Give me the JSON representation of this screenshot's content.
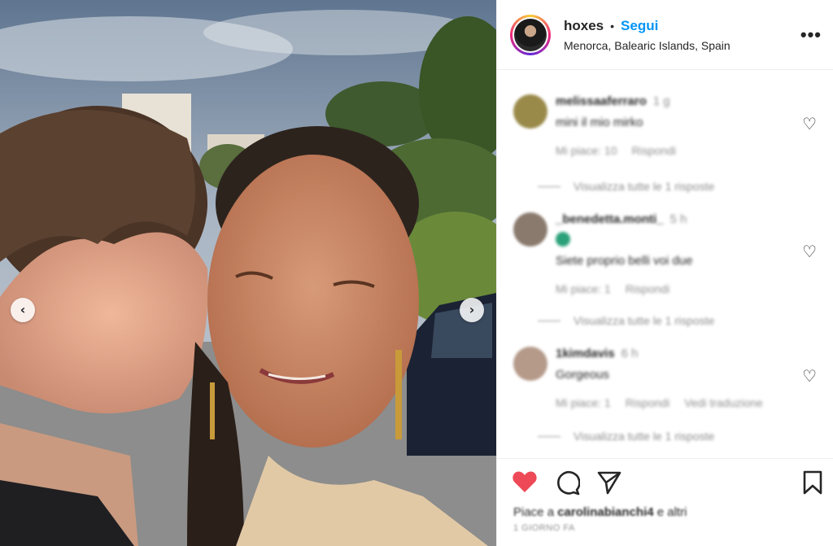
{
  "post": {
    "username": "hoxes",
    "separator": "•",
    "follow_label": "Segui",
    "location": "Menorca, Balearic Islands, Spain",
    "more_label": "•••"
  },
  "media": {
    "prev_glyph": "‹",
    "next_glyph": "›"
  },
  "comments": [
    {
      "user": "melissaaferraro",
      "time": "1 g",
      "text": "mini il mio mirko",
      "meta": [
        "Mi piace: 10",
        "Rispondi"
      ],
      "replies": "Visualizza tutte le 1 risposte",
      "avatar_color": "#9a8a4a",
      "verified": false
    },
    {
      "user": "_benedetta.monti_",
      "time": "5 h",
      "text": "Siete proprio belli voi due",
      "meta": [
        "Mi piace: 1",
        "Rispondi"
      ],
      "replies": "Visualizza tutte le 1 risposte",
      "avatar_color": "#8a7a6e",
      "verified": true
    },
    {
      "user": "1kimdavis",
      "time": "6 h",
      "text": "Gorgeous",
      "meta": [
        "Mi piace: 1",
        "Rispondi",
        "Vedi traduzione"
      ],
      "replies": "Visualizza tutte le 1 risposte",
      "avatar_color": "#b59a8a",
      "verified": false
    }
  ],
  "actions": {
    "like_icon": "heart-filled-icon",
    "comment_icon": "comment-icon",
    "share_icon": "send-icon",
    "save_icon": "bookmark-icon",
    "like_color": "#ed4956"
  },
  "likes": {
    "prefix": "Piace a ",
    "user": "carolinabianchi4",
    "suffix": " e altri"
  },
  "date": "1 GIORNO FA"
}
